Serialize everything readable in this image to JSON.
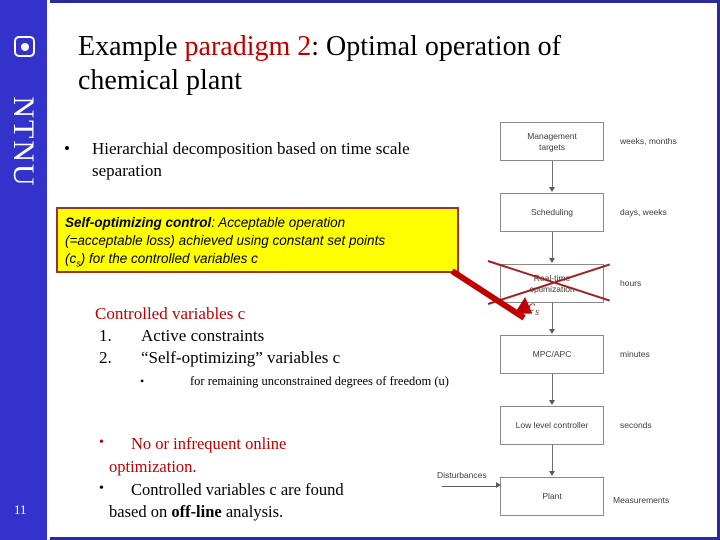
{
  "slide": {
    "page_number": "11",
    "logo_text": "NTNU",
    "sidebar_color": "#3333CC",
    "accent_color": "#C00000",
    "highlight_color": "#FFFF00"
  },
  "title": {
    "part1": "Example ",
    "accent": "paradigm 2",
    "part2": ": Optimal operation of chemical plant"
  },
  "bullet1": {
    "marker": "•",
    "text": "Hierarchial decomposition based on time scale separation"
  },
  "yellow_box": {
    "lead": "Self-optimizing control",
    "colon": ": ",
    "line1_rest": "Acceptable operation",
    "line2": "(=acceptable loss) achieved using constant set points",
    "line3_pre": "(c",
    "line3_sub": "s",
    "line3_post": ") for the controlled variables c"
  },
  "controlled_variables": {
    "heading": "Controlled variables c",
    "items": [
      {
        "num": "1.",
        "label": "Active constraints"
      },
      {
        "num": "2.",
        "label": "“Self-optimizing” variables c"
      }
    ],
    "sub_marker": "•",
    "sub_text": "for remaining unconstrained degrees of freedom  (u)"
  },
  "bottom_bullets": [
    {
      "marker": "•",
      "line1": "No or infrequent online",
      "line2": "optimization.",
      "color": "red"
    },
    {
      "marker": "•",
      "line1": "Controlled variables c are found",
      "line2_pre": "based on ",
      "line2_bold": "off-line",
      "line2_post": " analysis.",
      "color": "black"
    }
  ],
  "flowchart": {
    "boxes": [
      {
        "label": "Management\ntargets",
        "time": "weeks, months",
        "crossed": false
      },
      {
        "label": "Scheduling",
        "time": "days, weeks",
        "crossed": false
      },
      {
        "label": "Real-time\noptimization",
        "time": "hours",
        "crossed": true
      },
      {
        "label": "MPC/APC",
        "time": "minutes",
        "crossed": false
      },
      {
        "label": "Low level controller",
        "time": "seconds",
        "crossed": false
      },
      {
        "label": "Plant",
        "time": "Measurements",
        "crossed": false
      }
    ],
    "setpoint_label_pre": "c",
    "setpoint_label_sub": "s",
    "disturbances_label": "Disturbances"
  }
}
